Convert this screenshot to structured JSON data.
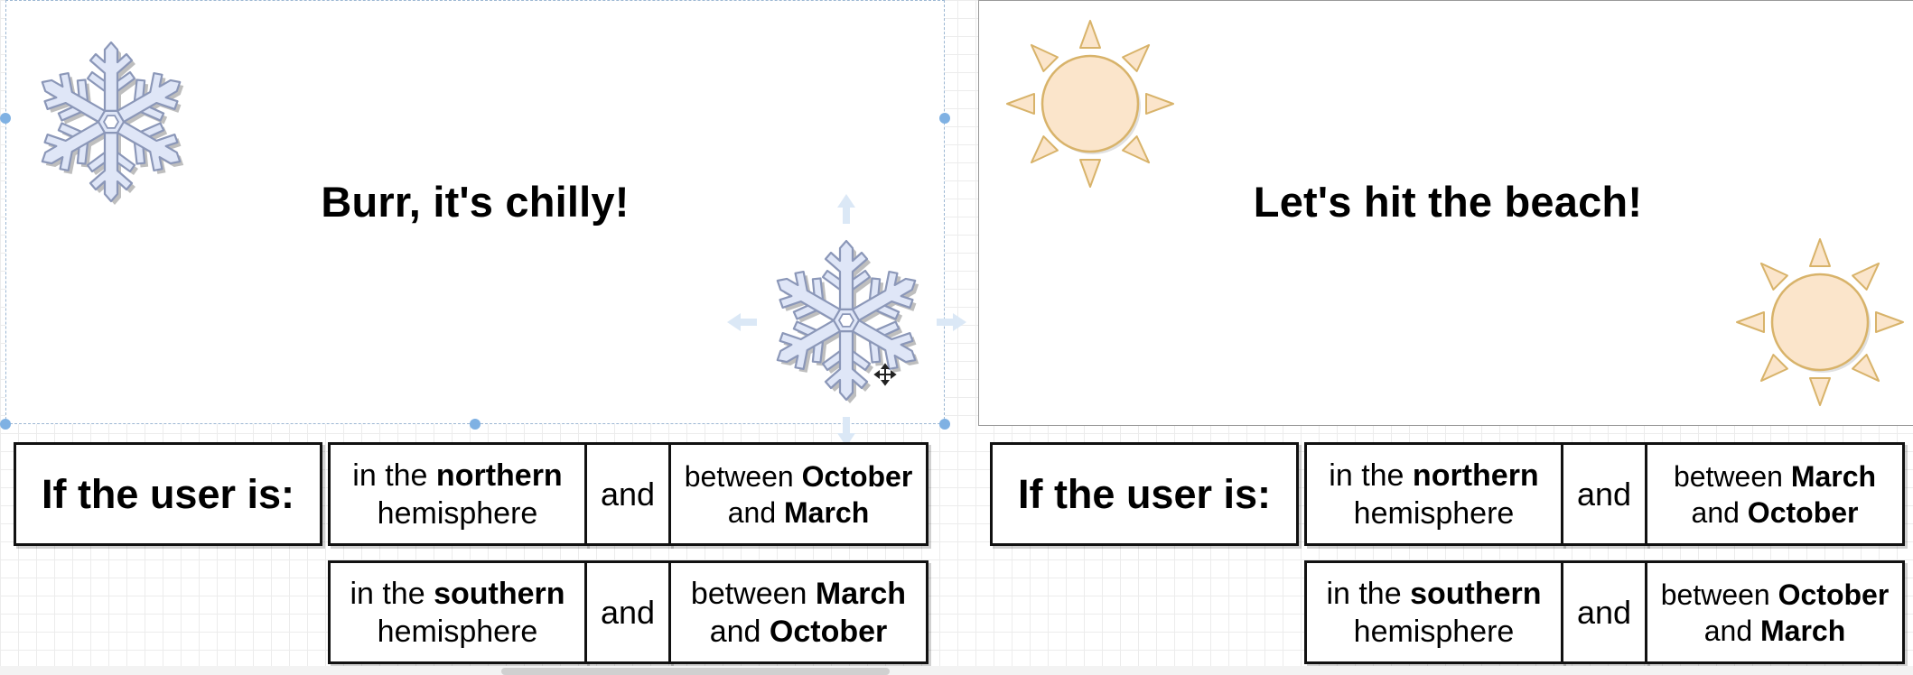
{
  "winter": {
    "title": "Burr, it's chilly!",
    "label": "If the user is:",
    "row1": {
      "prefix": "in the ",
      "bold": "northern",
      "suffix": "hemisphere",
      "and": "and",
      "range_prefix": "between ",
      "range_bold1": "October",
      "range_mid": "and ",
      "range_bold2": "March"
    },
    "row2": {
      "prefix": "in the ",
      "bold": "southern",
      "suffix": "hemisphere",
      "and": "and",
      "range_prefix": "between ",
      "range_bold1": "March",
      "range_mid": "and ",
      "range_bold2": "October"
    },
    "icon": "snowflake-icon",
    "icon_fill": "#dfe6f7",
    "icon_stroke": "#8b97b8"
  },
  "summer": {
    "title": "Let's hit the beach!",
    "label": "If the user is:",
    "row1": {
      "prefix": "in the ",
      "bold": "northern",
      "suffix": "hemisphere",
      "and": "and",
      "range_prefix": "between ",
      "range_bold1": "March",
      "range_mid": "and ",
      "range_bold2": "October"
    },
    "row2": {
      "prefix": "in the ",
      "bold": "southern",
      "suffix": "hemisphere",
      "and": "and",
      "range_prefix": "between ",
      "range_bold1": "October",
      "range_mid": "and ",
      "range_bold2": "March"
    },
    "icon": "sun-icon",
    "icon_fill": "#fbe5cb",
    "icon_stroke": "#d8b36a"
  },
  "colors": {
    "selection": "#7fb1e3",
    "border": "#111111"
  }
}
